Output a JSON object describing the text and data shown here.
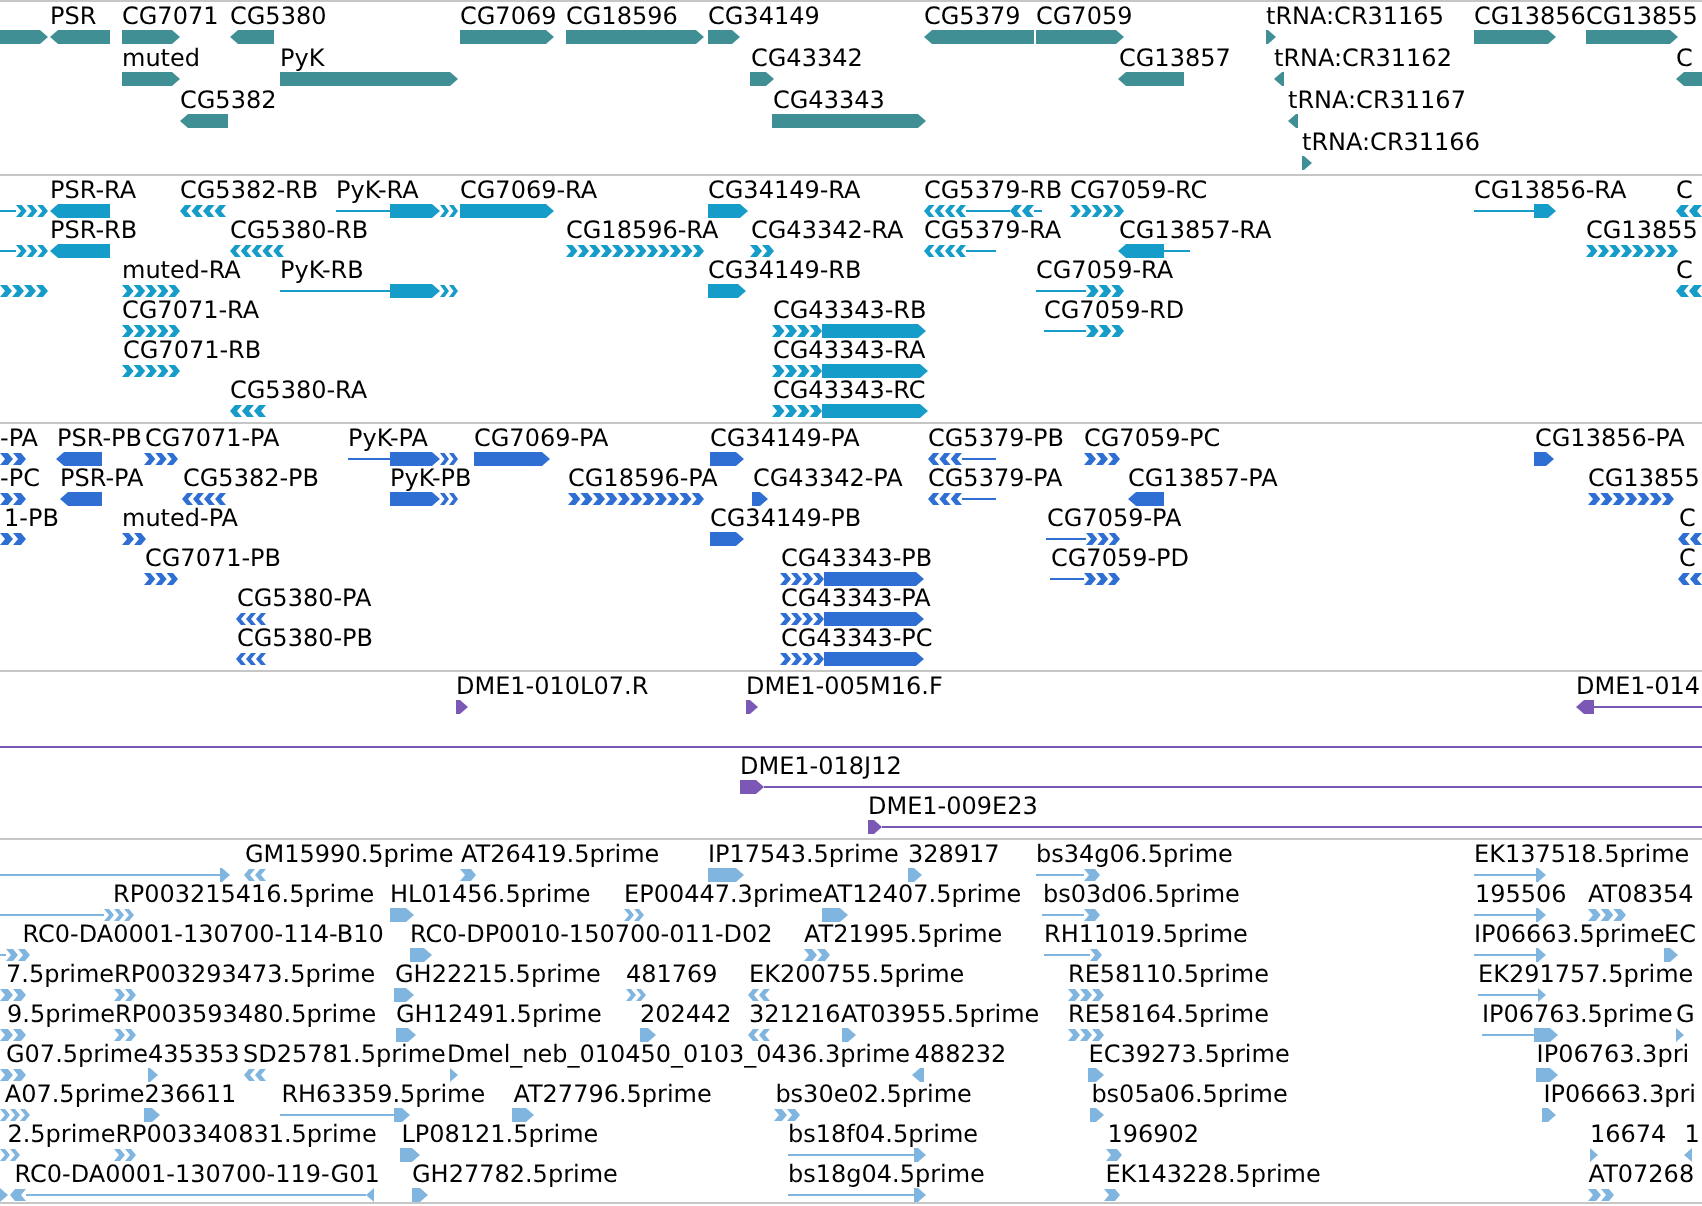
{
  "tracks": [
    {
      "color": "#3f8f94",
      "rows": [
        {
          "features": [
            {
              "reverse": false
            },
            {
              "label": "PSR",
              "reverse": true
            },
            {
              "label": "CG7071",
              "reverse": false
            },
            {
              "label": "CG5380",
              "reverse": true
            },
            {
              "label": "CG7069",
              "reverse": false
            },
            {
              "label": "CG18596",
              "reverse": false
            },
            {
              "label": "CG34149",
              "reverse": false
            },
            {
              "label": "CG5379",
              "reverse": true
            },
            {
              "label": "CG7059",
              "reverse": false
            },
            {
              "label": "tRNA:CR31165",
              "reverse": false
            },
            {
              "label": "CG13856",
              "reverse": false
            },
            {
              "label": "CG13855",
              "reverse": false
            }
          ]
        },
        {
          "features": [
            {
              "label": "muted",
              "reverse": false
            },
            {
              "label": "PyK",
              "reverse": false
            },
            {
              "label": "CG43342",
              "reverse": false
            },
            {
              "label": "CG13857",
              "reverse": true
            },
            {
              "label": "tRNA:CR31162",
              "reverse": true
            },
            {
              "label": "C",
              "reverse": true
            }
          ]
        },
        {
          "features": [
            {
              "label": "CG5382",
              "reverse": true
            },
            {
              "label": "CG43343",
              "reverse": false
            },
            {
              "label": "tRNA:CR31167",
              "reverse": true
            }
          ]
        },
        {
          "features": [
            {
              "label": "tRNA:CR31166",
              "reverse": false
            }
          ]
        }
      ]
    },
    {
      "color": "#169cc8",
      "rows": [
        {
          "features": [
            {
              "reverse": false
            },
            {
              "label": "PSR-RA",
              "reverse": true
            },
            {
              "label": "CG5382-RB",
              "reverse": true
            },
            {
              "label": "PyK-RA",
              "reverse": false
            },
            {
              "label": "CG7069-RA",
              "reverse": false
            },
            {
              "label": "CG34149-RA",
              "reverse": false
            },
            {
              "label": "CG5379-RB",
              "reverse": true
            },
            {
              "label": "CG7059-RC",
              "reverse": false
            },
            {
              "label": "CG13856-RA",
              "reverse": false
            },
            {
              "label": "C",
              "reverse": true
            }
          ]
        },
        {
          "features": [
            {
              "reverse": false
            },
            {
              "label": "PSR-RB",
              "reverse": true
            },
            {
              "label": "CG5380-RB",
              "reverse": true
            },
            {
              "label": "CG18596-RA",
              "reverse": false
            },
            {
              "label": "CG43342-RA",
              "reverse": false
            },
            {
              "label": "CG5379-RA",
              "reverse": true
            },
            {
              "label": "CG13857-RA",
              "reverse": true
            },
            {
              "label": "CG13855",
              "reverse": false
            }
          ]
        },
        {
          "features": [
            {
              "reverse": false
            },
            {
              "label": "muted-RA",
              "reverse": false
            },
            {
              "label": "PyK-RB",
              "reverse": false
            },
            {
              "label": "CG34149-RB",
              "reverse": false
            },
            {
              "label": "CG7059-RA",
              "reverse": false
            },
            {
              "label": "C",
              "reverse": true
            }
          ]
        },
        {
          "features": [
            {
              "label": "CG7071-RA",
              "reverse": false
            },
            {
              "label": "CG43343-RB",
              "reverse": false
            },
            {
              "label": "CG7059-RD",
              "reverse": false
            }
          ]
        },
        {
          "features": [
            {
              "label": "CG7071-RB",
              "reverse": false
            },
            {
              "label": "CG43343-RA",
              "reverse": false
            }
          ]
        },
        {
          "features": [
            {
              "label": "CG5380-RA",
              "reverse": true
            },
            {
              "label": "CG43343-RC",
              "reverse": false
            }
          ]
        }
      ]
    },
    {
      "color": "#2f6fd3",
      "rows": [
        {
          "features": [
            {
              "label": "-PA",
              "reverse": false
            },
            {
              "label": "PSR-PB",
              "reverse": true
            },
            {
              "label": "CG7071-PA",
              "reverse": false
            },
            {
              "label": "PyK-PA",
              "reverse": false
            },
            {
              "label": "CG7069-PA",
              "reverse": false
            },
            {
              "label": "CG34149-PA",
              "reverse": false
            },
            {
              "label": "CG5379-PB",
              "reverse": true
            },
            {
              "label": "CG7059-PC",
              "reverse": false
            },
            {
              "label": "CG13856-PA",
              "reverse": false
            }
          ]
        },
        {
          "features": [
            {
              "label": "-PC",
              "reverse": false
            },
            {
              "label": "PSR-PA",
              "reverse": true
            },
            {
              "label": "CG5382-PB",
              "reverse": true
            },
            {
              "label": "PyK-PB",
              "reverse": false
            },
            {
              "label": "CG18596-PA",
              "reverse": false
            },
            {
              "label": "CG43342-PA",
              "reverse": false
            },
            {
              "label": "CG5379-PA",
              "reverse": true
            },
            {
              "label": "CG13857-PA",
              "reverse": true
            },
            {
              "label": "CG13855",
              "reverse": false
            }
          ]
        },
        {
          "features": [
            {
              "label": "1-PB",
              "reverse": false
            },
            {
              "label": "muted-PA",
              "reverse": false
            },
            {
              "label": "CG34149-PB",
              "reverse": false
            },
            {
              "label": "CG7059-PA",
              "reverse": false
            },
            {
              "label": "C",
              "reverse": true
            }
          ]
        },
        {
          "features": [
            {
              "label": "CG7071-PB",
              "reverse": false
            },
            {
              "label": "CG43343-PB",
              "reverse": false
            },
            {
              "label": "CG7059-PD",
              "reverse": false
            },
            {
              "label": "C",
              "reverse": true
            }
          ]
        },
        {
          "features": [
            {
              "label": "CG5380-PA",
              "reverse": true
            },
            {
              "label": "CG43343-PA",
              "reverse": false
            }
          ]
        },
        {
          "features": [
            {
              "label": "CG5380-PB",
              "reverse": true
            },
            {
              "label": "CG43343-PC",
              "reverse": false
            }
          ]
        }
      ]
    },
    {
      "color": "#7b58b5",
      "rows": [
        {
          "features": [
            {
              "label": "DME1-010L07.R",
              "reverse": false
            },
            {
              "label": "DME1-005M16.F",
              "reverse": false
            },
            {
              "label": "DME1-014",
              "reverse": true
            }
          ]
        },
        {
          "features": [
            {
              "reverse": false
            }
          ]
        },
        {
          "features": [
            {
              "label": "DME1-018J12",
              "reverse": false
            }
          ]
        },
        {
          "features": [
            {
              "label": "DME1-009E23",
              "reverse": false
            }
          ]
        }
      ]
    },
    {
      "color": "#80b5e0",
      "rows": [
        {
          "features": [
            {
              "reverse": false
            },
            {
              "label": "GM15990.5prime",
              "reverse": true
            },
            {
              "label": "AT26419.5prime",
              "reverse": false
            },
            {
              "label": "IP17543.5prime",
              "reverse": false
            },
            {
              "label": "328917",
              "reverse": false
            },
            {
              "label": "bs34g06.5prime",
              "reverse": false
            },
            {
              "label": "EK137518.5prime",
              "reverse": false
            }
          ]
        },
        {
          "features": [
            {
              "label": "RP003215416.5prime",
              "reverse": false
            },
            {
              "label": "HL01456.5prime",
              "reverse": false
            },
            {
              "label": "EP00447.3prime",
              "reverse": false
            },
            {
              "label": "AT12407.5prime",
              "reverse": false
            },
            {
              "label": "bs03d06.5prime",
              "reverse": false
            },
            {
              "label": "195506",
              "reverse": false
            },
            {
              "label": "AT08354",
              "reverse": false
            }
          ]
        },
        {
          "features": [
            {
              "label": "RC0-DA0001-130700-114-B10",
              "reverse": false
            },
            {
              "label": "RC0-DP0010-150700-011-D02",
              "reverse": false
            },
            {
              "label": "AT21995.5prime",
              "reverse": false
            },
            {
              "label": "RH11019.5prime",
              "reverse": false
            },
            {
              "label": "IP06663.5prime",
              "reverse": false
            },
            {
              "label": "EC",
              "reverse": false
            }
          ]
        },
        {
          "features": [
            {
              "label": "7.5prime",
              "reverse": false
            },
            {
              "label": "RP003293473.5prime",
              "reverse": false
            },
            {
              "label": "GH22215.5prime",
              "reverse": false
            },
            {
              "label": "481769",
              "reverse": false
            },
            {
              "label": "EK200755.5prime",
              "reverse": true
            },
            {
              "label": "RE58110.5prime",
              "reverse": false
            },
            {
              "label": "EK291757.5prime",
              "reverse": false
            }
          ]
        },
        {
          "features": [
            {
              "label": "9.5prime",
              "reverse": false
            },
            {
              "label": "RP003593480.5prime",
              "reverse": false
            },
            {
              "label": "GH12491.5prime",
              "reverse": false
            },
            {
              "label": "202442",
              "reverse": false
            },
            {
              "label": "321216",
              "reverse": true
            },
            {
              "label": "AT03955.5prime",
              "reverse": false
            },
            {
              "label": "RE58164.5prime",
              "reverse": false
            },
            {
              "label": "IP06763.5prime",
              "reverse": false
            },
            {
              "label": "G",
              "reverse": false
            }
          ]
        },
        {
          "features": [
            {
              "label": "G07.5prime",
              "reverse": false
            },
            {
              "label": "435353",
              "reverse": false
            },
            {
              "label": "SD25781.5prime",
              "reverse": true
            },
            {
              "label": "Dmel_neb_010450_0103_0436.3prime",
              "reverse": false
            },
            {
              "label": "488232",
              "reverse": true
            },
            {
              "label": "EC39273.5prime",
              "reverse": false
            },
            {
              "label": "IP06763.3pri",
              "reverse": false
            }
          ]
        },
        {
          "features": [
            {
              "label": "A07.5prime",
              "reverse": false
            },
            {
              "label": "236611",
              "reverse": false
            },
            {
              "label": "RH63359.5prime",
              "reverse": false
            },
            {
              "label": "AT27796.5prime",
              "reverse": false
            },
            {
              "label": "bs30e02.5prime",
              "reverse": false
            },
            {
              "label": "bs05a06.5prime",
              "reverse": false
            },
            {
              "label": "IP06663.3pri",
              "reverse": false
            }
          ]
        },
        {
          "features": [
            {
              "label": "2.5prime",
              "reverse": false
            },
            {
              "label": "RP003340831.5prime",
              "reverse": false
            },
            {
              "label": "LP08121.5prime",
              "reverse": false
            },
            {
              "label": "bs18f04.5prime",
              "reverse": false
            },
            {
              "label": "196902",
              "reverse": false
            },
            {
              "label": "16674",
              "reverse": false
            },
            {
              "label": "1",
              "reverse": true
            }
          ]
        },
        {
          "features": [
            {
              "reverse": false
            },
            {
              "label": "RC0-DA0001-130700-119-G01",
              "reverse": true
            },
            {
              "label": "GH27782.5prime",
              "reverse": false
            },
            {
              "label": "bs18g04.5prime",
              "reverse": false
            },
            {
              "label": "EK143228.5prime",
              "reverse": false
            },
            {
              "label": "AT07268",
              "reverse": false
            }
          ]
        }
      ]
    }
  ]
}
